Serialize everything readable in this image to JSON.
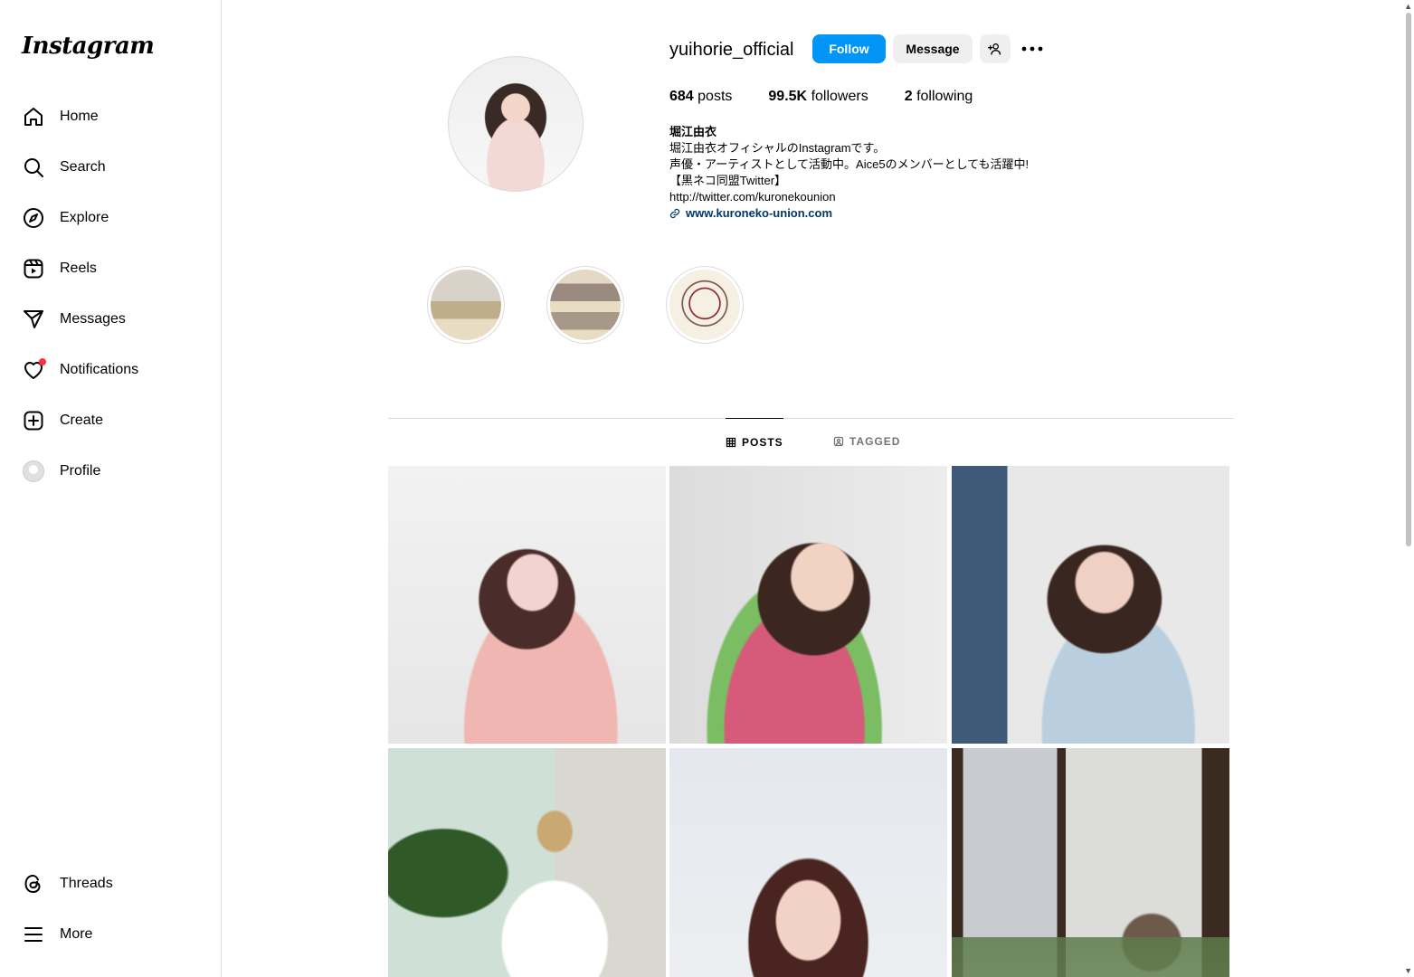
{
  "app": {
    "logo": "Instagram"
  },
  "sidebar": {
    "items": [
      {
        "label": "Home",
        "icon": "home-icon"
      },
      {
        "label": "Search",
        "icon": "search-icon"
      },
      {
        "label": "Explore",
        "icon": "compass-icon"
      },
      {
        "label": "Reels",
        "icon": "reels-icon"
      },
      {
        "label": "Messages",
        "icon": "send-icon"
      },
      {
        "label": "Notifications",
        "icon": "heart-icon"
      },
      {
        "label": "Create",
        "icon": "plus-square-icon"
      },
      {
        "label": "Profile",
        "icon": "avatar-icon"
      }
    ],
    "bottom": [
      {
        "label": "Threads",
        "icon": "threads-icon"
      },
      {
        "label": "More",
        "icon": "menu-icon"
      }
    ]
  },
  "profile": {
    "username": "yuihorie_official",
    "follow_label": "Follow",
    "message_label": "Message",
    "stats": {
      "posts_count": "684",
      "posts_label": "posts",
      "followers_count": "99.5K",
      "followers_label": "followers",
      "following_count": "2",
      "following_label": "following"
    },
    "bio": {
      "name": "堀江由衣",
      "line1": "堀江由衣オフィシャルのInstagramです。",
      "line2": "声優・アーティストとして活動中。Aice5のメンバーとしても活躍中!",
      "line3": "【黒ネコ同盟Twitter】",
      "line4": "http://twitter.com/kuronekounion",
      "link": "www.kuroneko-union.com"
    }
  },
  "tabs": {
    "posts": "POSTS",
    "tagged": "TAGGED"
  },
  "colors": {
    "accent": "#0095f6",
    "link": "#00376b",
    "notification": "#ff3040"
  }
}
